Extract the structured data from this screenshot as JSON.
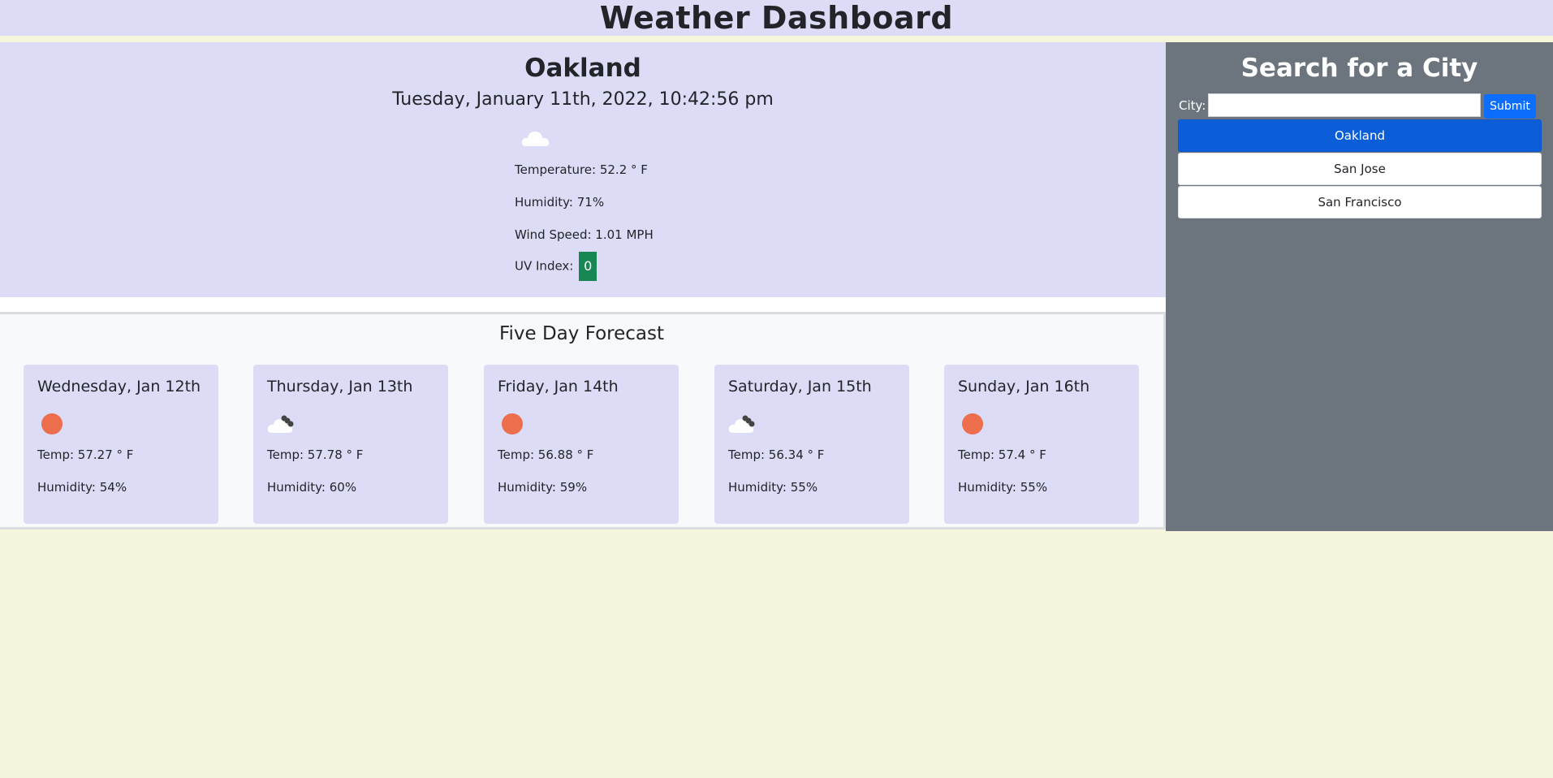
{
  "header": {
    "title": "Weather Dashboard"
  },
  "current": {
    "city": "Oakland",
    "date": "Tuesday, January 11th, 2022, 10:42:56 pm",
    "icon": "cloud-icon",
    "temperature": "Temperature: 52.2 ° F",
    "humidity": "Humidity: 71%",
    "wind": "Wind Speed: 1.01 MPH",
    "uv_label": "UV Index:",
    "uv_value": "0",
    "uv_color": "#198754"
  },
  "forecast": {
    "title": "Five Day Forecast",
    "days": [
      {
        "day": "Wednesday, Jan 12th",
        "icon": "sun-icon",
        "temp": "Temp: 57.27 ° F",
        "humidity": "Humidity: 54%"
      },
      {
        "day": "Thursday, Jan 13th",
        "icon": "cloud-icon",
        "temp": "Temp: 57.78 ° F",
        "humidity": "Humidity: 60%"
      },
      {
        "day": "Friday, Jan 14th",
        "icon": "sun-icon",
        "temp": "Temp: 56.88 ° F",
        "humidity": "Humidity: 59%"
      },
      {
        "day": "Saturday, Jan 15th",
        "icon": "cloud-icon",
        "temp": "Temp: 56.34 ° F",
        "humidity": "Humidity: 55%"
      },
      {
        "day": "Sunday, Jan 16th",
        "icon": "sun-icon",
        "temp": "Temp: 57.4 ° F",
        "humidity": "Humidity: 55%"
      }
    ]
  },
  "sidebar": {
    "title": "Search for a City",
    "city_label": "City:",
    "input_value": "",
    "input_placeholder": "",
    "submit_label": "Submit",
    "history": [
      "Oakland",
      "San Jose",
      "San Francisco"
    ]
  },
  "colors": {
    "panel": "#dcdcf6",
    "page": "#f5f5dc",
    "sidebar": "#6c757d",
    "primary": "#0d6efd",
    "active_history": "#0b5ed7",
    "sun": "#ec6e4c"
  }
}
